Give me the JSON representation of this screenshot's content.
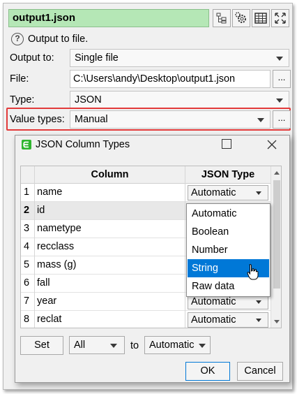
{
  "output_name": "output1.json",
  "help_text": "Output to file.",
  "output_to": {
    "label": "Output to:",
    "value": "Single file"
  },
  "file": {
    "label": "File:",
    "value": "C:\\Users\\andy\\Desktop\\output1.json",
    "browse_label": "..."
  },
  "type": {
    "label": "Type:",
    "value": "JSON"
  },
  "value_types": {
    "label": "Value types:",
    "value": "Manual",
    "browse_label": "..."
  },
  "dialog": {
    "title": "JSON Column Types",
    "columns": [
      "Column",
      "JSON Type"
    ],
    "rows": [
      {
        "num": "1",
        "name": "name",
        "type": "Automatic"
      },
      {
        "num": "2",
        "name": "id",
        "type": ""
      },
      {
        "num": "3",
        "name": "nametype",
        "type": ""
      },
      {
        "num": "4",
        "name": "recclass",
        "type": ""
      },
      {
        "num": "5",
        "name": "mass (g)",
        "type": ""
      },
      {
        "num": "6",
        "name": "fall",
        "type": ""
      },
      {
        "num": "7",
        "name": "year",
        "type": "Automatic"
      },
      {
        "num": "8",
        "name": "reclat",
        "type": "Automatic"
      }
    ],
    "dropdown_options": [
      "Automatic",
      "Boolean",
      "Number",
      "String",
      "Raw data"
    ],
    "dropdown_selected": "String",
    "set_button": "Set",
    "set_scope": "All",
    "to_label": "to",
    "to_value": "Automatic",
    "ok": "OK",
    "cancel": "Cancel"
  },
  "colors": {
    "name_field_bg": "#b5e7b6",
    "highlight": "#e23a3a",
    "selection": "#0078d7",
    "logo": "#2fb52f"
  }
}
